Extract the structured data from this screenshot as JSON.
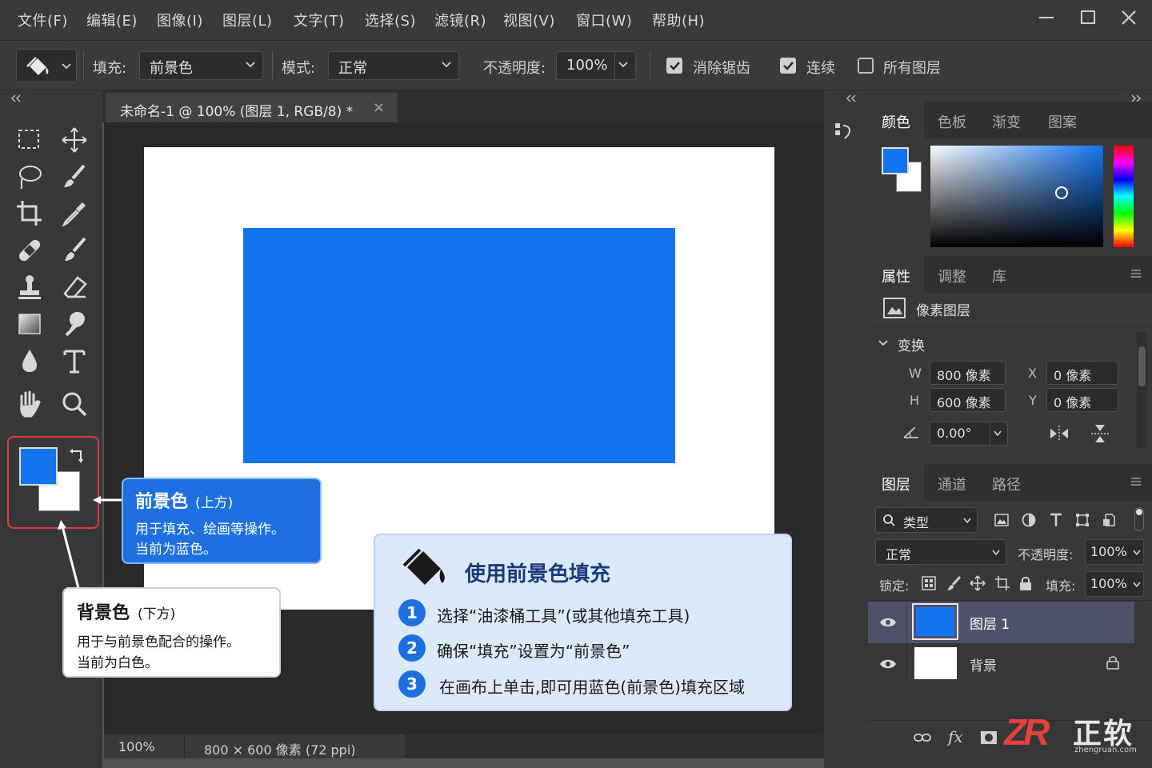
{
  "menubar": {
    "items": [
      "文件(F)",
      "编辑(E)",
      "图像(I)",
      "图层(L)",
      "文字(T)",
      "选择(S)",
      "滤镜(R)",
      "视图(V)",
      "窗口(W)",
      "帮助(H)"
    ]
  },
  "options": {
    "fill_label": "填充:",
    "fill_value": "前景色",
    "mode_label": "模式:",
    "mode_value": "正常",
    "opacity_label": "不透明度:",
    "opacity_value": "100%",
    "antialias_label": "消除锯齿",
    "contiguous_label": "连续",
    "all_layers_label": "所有图层"
  },
  "document": {
    "tab_title": "未命名-1 @ 100% (图层 1, RGB/8) *",
    "close_glyph": "×",
    "fill_color": "#1474f0"
  },
  "status": {
    "zoom": "100%",
    "info": "800 × 600 像素 (72 ppi)"
  },
  "colors": {
    "foreground": "#1474f0",
    "background": "#ffffff",
    "highlight": "#e03a3a"
  },
  "color_panel": {
    "tabs": [
      "颜色",
      "色板",
      "渐变",
      "图案"
    ]
  },
  "properties_panel": {
    "tabs": [
      "属性",
      "调整",
      "库"
    ],
    "layer_type": "像素图层",
    "transform_label": "变换",
    "w_label": "W",
    "w_value": "800 像素",
    "h_label": "H",
    "h_value": "600 像素",
    "x_label": "X",
    "x_value": "0 像素",
    "y_label": "Y",
    "y_value": "0 像素",
    "angle_value": "0.00°"
  },
  "layers_panel": {
    "tabs": [
      "图层",
      "通道",
      "路径"
    ],
    "filter_label": "类型",
    "blend_mode": "正常",
    "opacity_label": "不透明度:",
    "opacity_value": "100%",
    "lock_label": "锁定:",
    "fill_label": "填充:",
    "fill_value": "100%",
    "layers": [
      {
        "name": "图层 1"
      },
      {
        "name": "背景"
      }
    ]
  },
  "callouts": {
    "foreground": {
      "title": "前景色",
      "title_note": "(上方)",
      "line1": "用于填充、绘画等操作。",
      "line2": "当前为蓝色。"
    },
    "background": {
      "title": "背景色",
      "title_note": "(下方)",
      "line1": "用于与前景色配合的操作。",
      "line2": "当前为白色。"
    },
    "howto": {
      "title": "使用前景色填充",
      "steps": [
        {
          "num": "1",
          "text": "选择“油漆桶工具”(或其他填充工具)"
        },
        {
          "num": "2",
          "text": "确保“填充”设置为“前景色”"
        },
        {
          "num": "3",
          "text": "在画布上单击,即可用蓝色(前景色)填充区域"
        }
      ]
    }
  },
  "watermark": {
    "logo": "ZR",
    "brand": "正软",
    "url": "zhengruan.com"
  }
}
